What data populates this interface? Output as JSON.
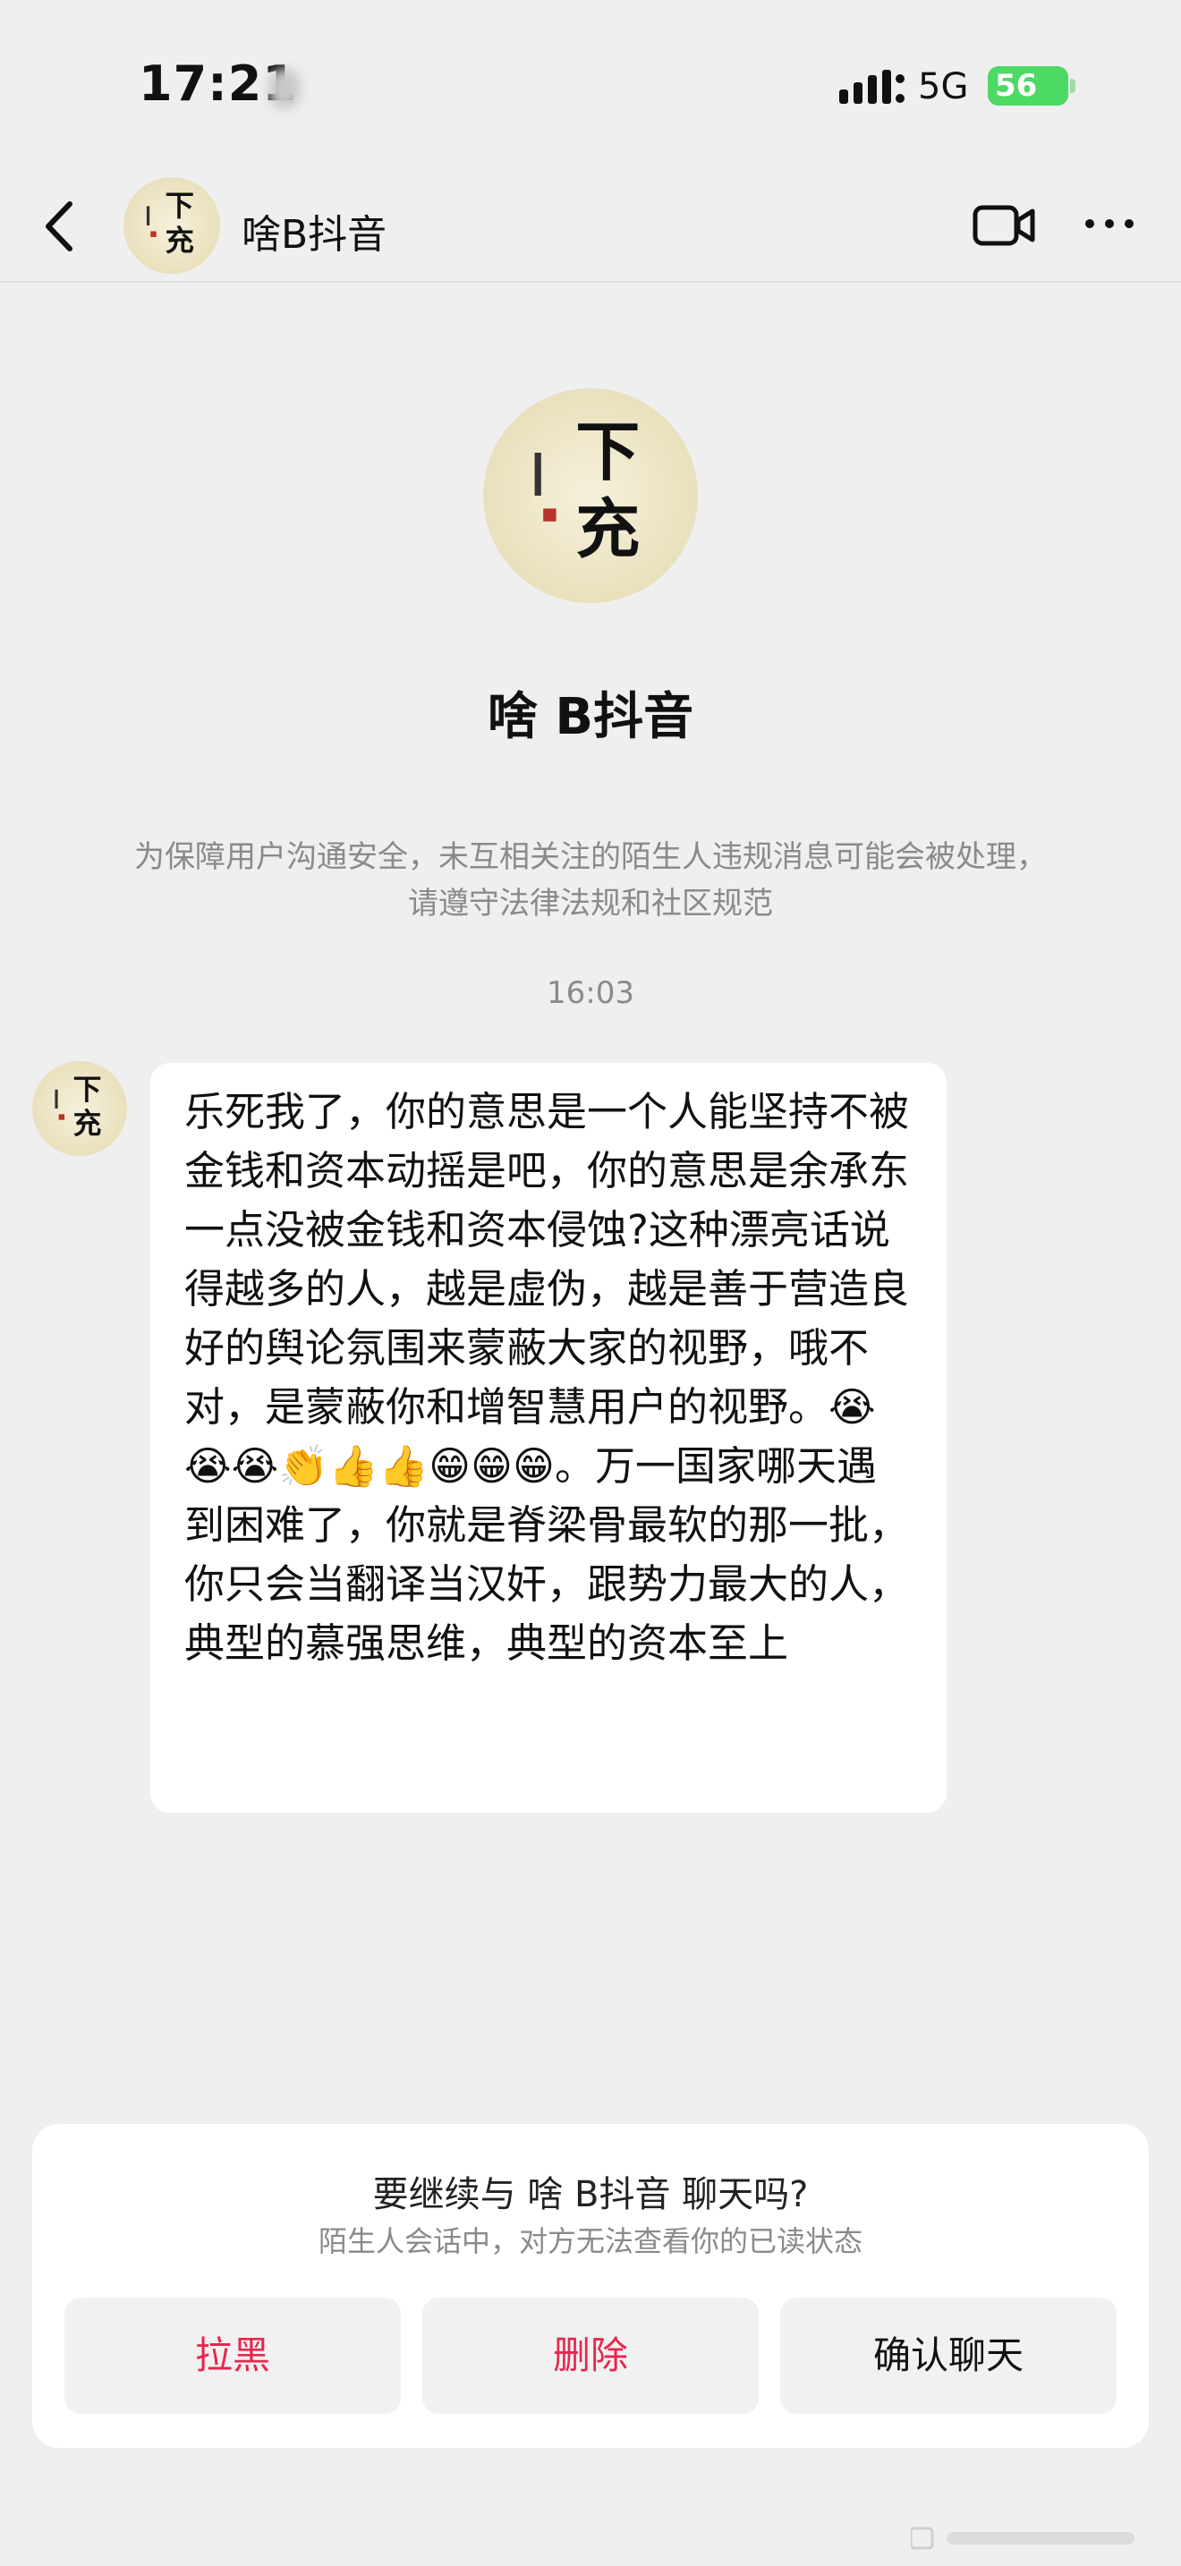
{
  "status_bar": {
    "time": "17:21",
    "network": "5G",
    "battery": "56"
  },
  "header": {
    "title": "啥B抖音"
  },
  "avatar_art": {
    "line1": "下",
    "line2": "充"
  },
  "profile": {
    "name": "啥 B抖音",
    "notice": "为保障用户沟通安全，未互相关注的陌生人违规消息可能会被处理，请遵守法律法规和社区规范",
    "timestamp": "16:03"
  },
  "message": {
    "text": "乐死我了，你的意思是一个人能坚持不被金钱和资本动摇是吧，你的意思是余承东一点没被金钱和资本侵蚀?这种漂亮话说得越多的人，越是虚伪，越是善于营造良好的舆论氛围来蒙蔽大家的视野，哦不对，是蒙蔽你和增智慧用户的视野。😭😭😭👏👍👍😁😁😁。万一国家哪天遇到困难了，你就是脊梁骨最软的那一批，你只会当翻译当汉奸，跟势力最大的人，典型的慕强思维，典型的资本至上"
  },
  "confirm_card": {
    "title": "要继续与 啥 B抖音 聊天吗?",
    "subtitle": "陌生人会话中，对方无法查看你的已读状态",
    "buttons": {
      "block": "拉黑",
      "delete": "删除",
      "confirm": "确认聊天"
    }
  },
  "colors": {
    "accent": "#e8264e",
    "battery": "#4cd964",
    "background": "#efefef"
  }
}
